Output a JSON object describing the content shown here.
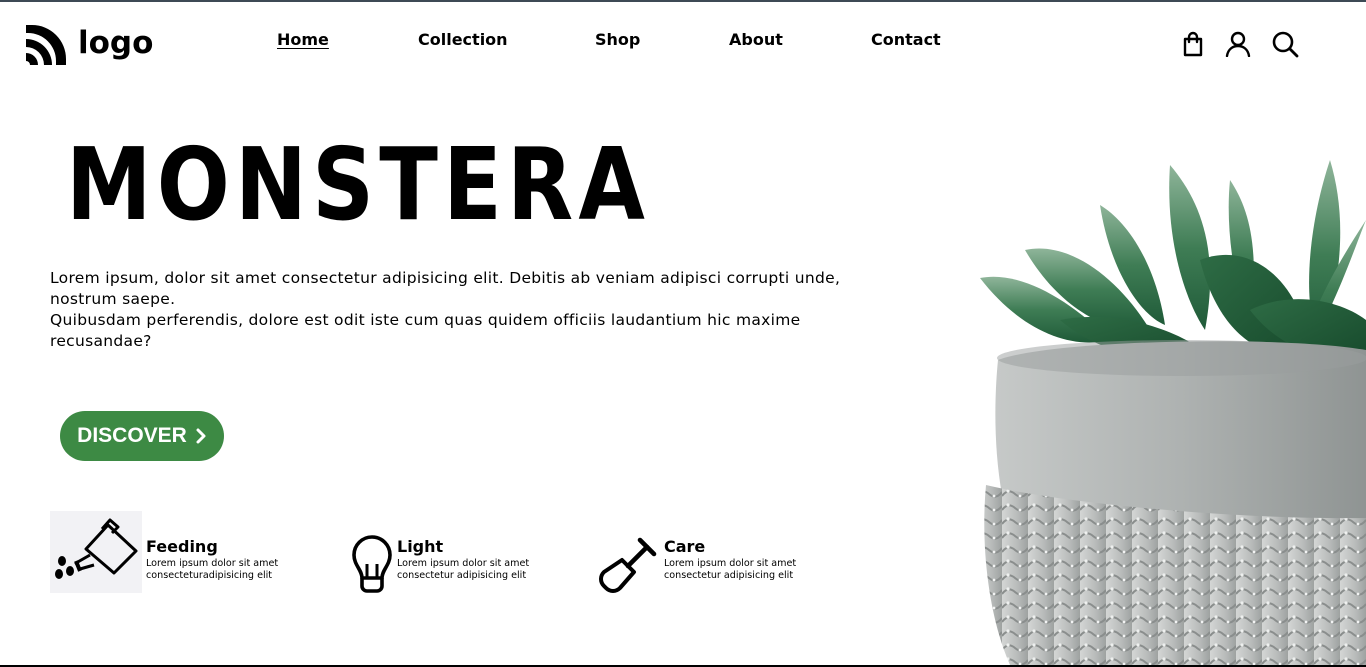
{
  "header": {
    "logo_text": "logo",
    "nav": [
      {
        "label": "Home",
        "active": true
      },
      {
        "label": "Collection",
        "active": false
      },
      {
        "label": "Shop",
        "active": false
      },
      {
        "label": "About",
        "active": false
      },
      {
        "label": "Contact",
        "active": false
      }
    ],
    "icons": [
      "shopping-bag-icon",
      "user-icon",
      "search-icon"
    ]
  },
  "hero": {
    "title": "MONSTERA",
    "description_line1": "Lorem ipsum, dolor sit amet consectetur adipisicing elit. Debitis ab veniam adipisci corrupti unde, nostrum saepe.",
    "description_line2": "Quibusdam perferendis, dolore est odit iste cum quas quidem officiis laudantium hic maxime recusandae?",
    "cta_label": "DISCOVER"
  },
  "features": [
    {
      "icon": "watering-can-icon",
      "title": "Feeding",
      "line1": "Lorem ipsum dolor sit amet",
      "line2": "consecteturadipisicing elit"
    },
    {
      "icon": "light-bulb-icon",
      "title": "Light",
      "line1": "Lorem ipsum dolor sit amet",
      "line2": "consectetur adipisicing elit"
    },
    {
      "icon": "shovel-icon",
      "title": "Care",
      "line1": "Lorem ipsum dolor sit amet",
      "line2": "consectetur adipisicing elit"
    }
  ],
  "colors": {
    "accent": "#3d8a44",
    "text": "#000000",
    "background": "#ffffff"
  }
}
